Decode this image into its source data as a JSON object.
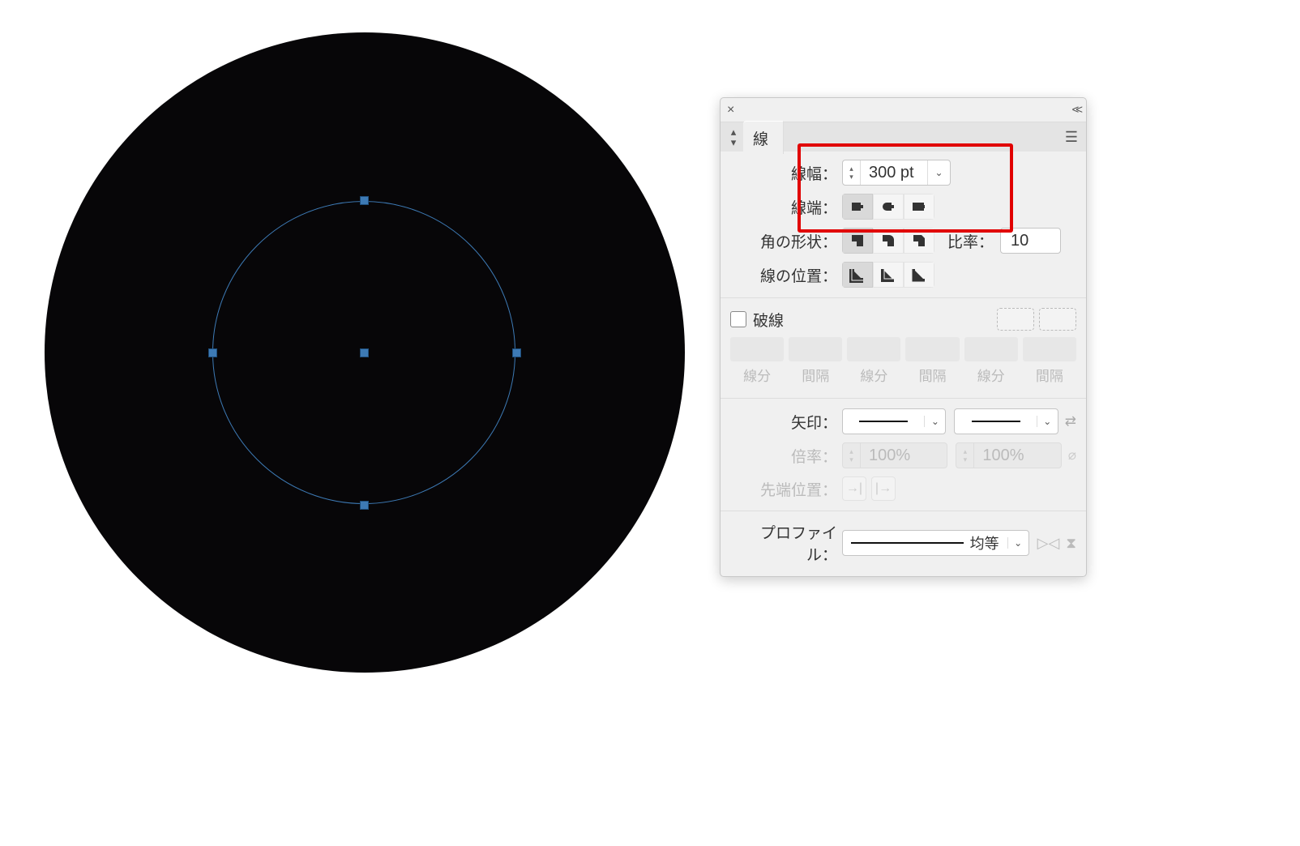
{
  "canvas": {
    "selected_shape": "circle-path",
    "stroke_render_diameter_px": 790
  },
  "panel": {
    "title_tab": "線",
    "stroke_weight": {
      "label": "線幅：",
      "value": "300 pt"
    },
    "caps": {
      "label": "線端：",
      "options": [
        "butt-cap",
        "round-cap",
        "projecting-cap"
      ],
      "selected_index": 0
    },
    "corners": {
      "label": "角の形状：",
      "options": [
        "miter-join",
        "round-join",
        "bevel-join"
      ],
      "selected_index": 0,
      "limit_label": "比率：",
      "limit_value": "10"
    },
    "align_stroke": {
      "label": "線の位置：",
      "options": [
        "align-center",
        "align-inside",
        "align-outside"
      ],
      "selected_index": 0
    },
    "dashed": {
      "checkbox_label": "破線",
      "checked": false,
      "columns": [
        "線分",
        "間隔",
        "線分",
        "間隔",
        "線分",
        "間隔"
      ],
      "values": [
        "",
        "",
        "",
        "",
        "",
        ""
      ]
    },
    "arrowheads": {
      "label": "矢印：",
      "start": "none",
      "end": "none"
    },
    "scale": {
      "label": "倍率：",
      "start": "100%",
      "end": "100%"
    },
    "tip_align": {
      "label": "先端位置："
    },
    "profile": {
      "label": "プロファイル：",
      "value": "均等"
    }
  }
}
